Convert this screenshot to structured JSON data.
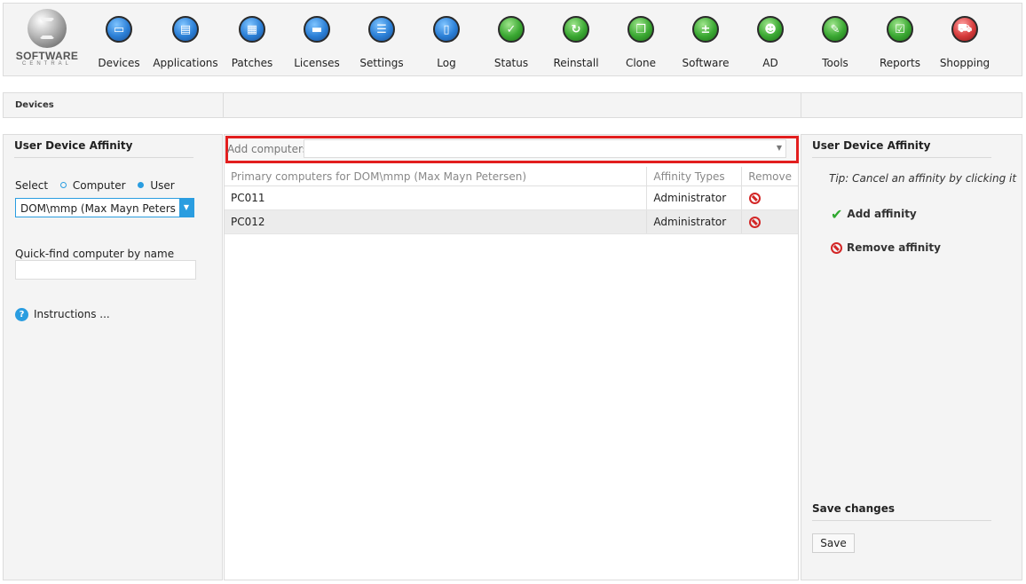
{
  "logo": {
    "title": "SOFTWARE",
    "subtitle": "CENTRAL"
  },
  "nav": [
    {
      "label": "Devices",
      "icon": "monitor-icon"
    },
    {
      "label": "Applications",
      "icon": "applications-icon"
    },
    {
      "label": "Patches",
      "icon": "patches-icon"
    },
    {
      "label": "Licenses",
      "icon": "licenses-icon"
    },
    {
      "label": "Settings",
      "icon": "settings-icon"
    },
    {
      "label": "Log",
      "icon": "log-icon"
    },
    {
      "label": "Status",
      "icon": "status-check-icon"
    },
    {
      "label": "Reinstall",
      "icon": "reinstall-icon"
    },
    {
      "label": "Clone",
      "icon": "clone-icon"
    },
    {
      "label": "Software",
      "icon": "software-icon"
    },
    {
      "label": "AD",
      "icon": "ad-users-icon"
    },
    {
      "label": "Tools",
      "icon": "tools-icon"
    },
    {
      "label": "Reports",
      "icon": "reports-icon"
    },
    {
      "label": "Shopping",
      "icon": "shopping-cart-icon"
    }
  ],
  "breadcrumb": "Devices",
  "left": {
    "title": "User Device Affinity",
    "select_label": "Select",
    "option_computer": "Computer",
    "option_user": "User",
    "selected_user": "DOM\\mmp (Max Mayn Petersen)",
    "quickfind_label": "Quick-find computer by name",
    "quickfind_value": "",
    "instructions": "Instructions ..."
  },
  "center": {
    "add_label": "Add computers:",
    "add_value": "",
    "columns": {
      "primary": "Primary computers for DOM\\mmp (Max Mayn Petersen)",
      "affinity": "Affinity Types",
      "remove": "Remove"
    },
    "rows": [
      {
        "computer": "PC011",
        "affinity": "Administrator"
      },
      {
        "computer": "PC012",
        "affinity": "Administrator"
      }
    ]
  },
  "right": {
    "title": "User Device Affinity",
    "tip": "Tip: Cancel an affinity by clicking it",
    "add_affinity": "Add affinity",
    "remove_affinity": "Remove affinity",
    "save_title": "Save changes",
    "save_button": "Save"
  },
  "colors": {
    "accent": "#2a9de0",
    "highlight": "#e21e1e",
    "remove": "#d32626",
    "add": "#2fa82f"
  }
}
